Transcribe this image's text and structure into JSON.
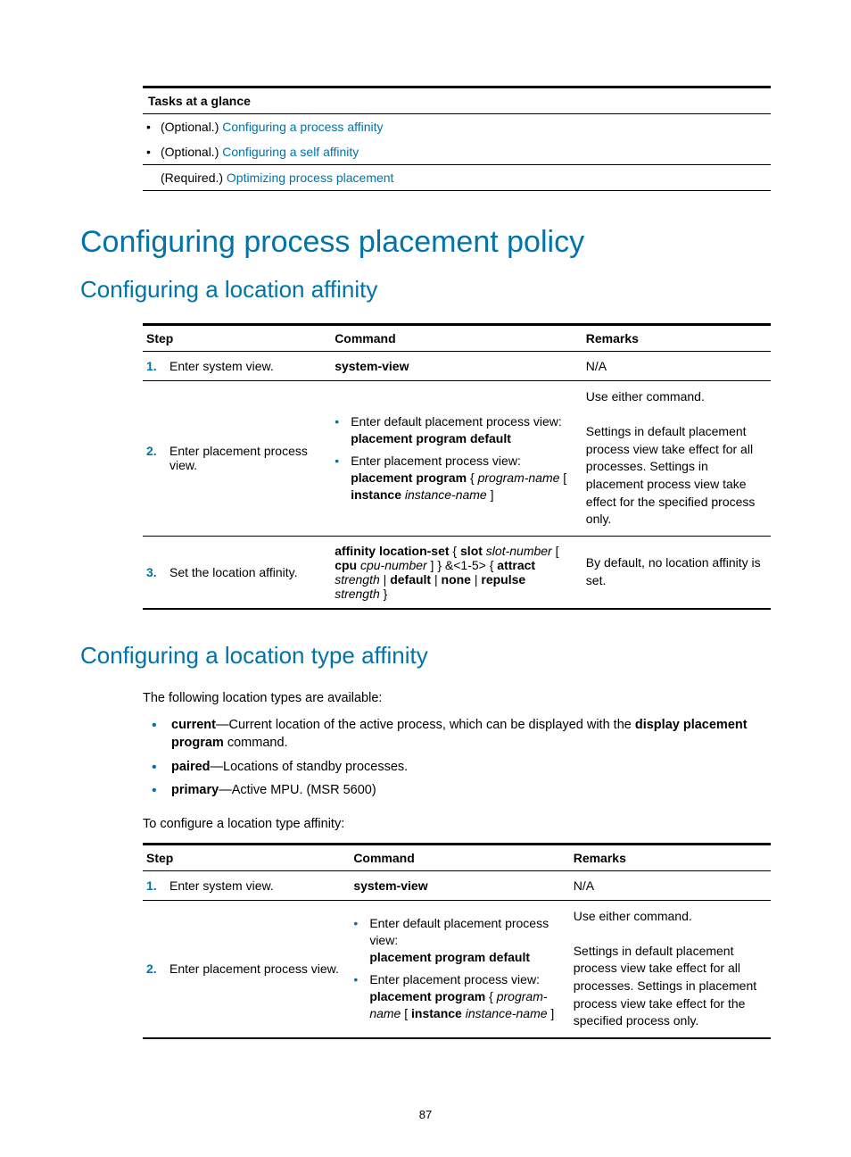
{
  "tasksBox": {
    "header": "Tasks at a glance",
    "rows": [
      {
        "prefix": "(Optional.) ",
        "link": "Configuring a process affinity",
        "bullet": true
      },
      {
        "prefix": "(Optional.) ",
        "link": "Configuring a self affinity",
        "bullet": true
      },
      {
        "prefix": "(Required.) ",
        "link": "Optimizing process placement",
        "bullet": false
      }
    ]
  },
  "h1": "Configuring process placement policy",
  "h2a": "Configuring a location affinity",
  "table1": {
    "headers": {
      "step": "Step",
      "command": "Command",
      "remarks": "Remarks"
    },
    "rows": [
      {
        "num": "1.",
        "desc": "Enter system view.",
        "command_html": "<span class='b'>system-view</span>",
        "remarks_html": "N/A"
      },
      {
        "num": "2.",
        "desc": "Enter placement process view.",
        "command_html": "<ul class='cmd-list'><li>Enter default placement process view:<br><span class='b'>placement program default</span></li><li>Enter placement process view:<br><span class='b'>placement program</span> { <span class='i'>program-name</span> [ <span class='b'>instance</span> <span class='i'>instance-name</span> ]</li></ul>",
        "remarks_html": "<div class='rem-text'>Use either command.<br><br>Settings in default placement process view take effect for all processes. Settings in placement process view take effect for the specified process only.</div>"
      },
      {
        "num": "3.",
        "desc": "Set the location affinity.",
        "command_html": "<span class='b'>affinity location-set</span> { <span class='b'>slot</span> <span class='i'>slot-number</span> [ <span class='b'>cpu</span> <span class='i'>cpu-number</span> ] } &amp;&lt;1-5&gt; { <span class='b'>attract</span> <span class='i'>strength</span> | <span class='b'>default</span> | <span class='b'>none</span> | <span class='b'>repulse</span> <span class='i'>strength</span> }",
        "remarks_html": "<div class='rem-text'>By default, no location affinity is set.</div>"
      }
    ]
  },
  "h2b": "Configuring a location type affinity",
  "para1": "The following location types are available:",
  "typeList": [
    "<span class='b'>current</span>—Current location of the active process, which can be displayed with the <span class='b'>display placement program</span> command.",
    "<span class='b'>paired</span>—Locations of standby processes.",
    "<span class='b'>primary</span>—Active MPU. (MSR 5600)"
  ],
  "para2": "To configure a location type affinity:",
  "table2": {
    "headers": {
      "step": "Step",
      "command": "Command",
      "remarks": "Remarks"
    },
    "rows": [
      {
        "num": "1.",
        "desc": "Enter system view.",
        "command_html": "<span class='b'>system-view</span>",
        "remarks_html": "N/A"
      },
      {
        "num": "2.",
        "desc": "Enter placement process view.",
        "command_html": "<ul class='cmd-list'><li>Enter default placement process view:<br><span class='b'>placement program default</span></li><li>Enter placement process view:<br><span class='b'>placement program</span> { <span class='i'>program-name</span> [ <span class='b'>instance</span> <span class='i'>instance-name</span> ]</li></ul>",
        "remarks_html": "<div class='rem-text'>Use either command.<br><br>Settings in default placement process view take effect for all processes. Settings in placement process view take effect for the specified process only.</div>"
      }
    ]
  },
  "pageNumber": "87"
}
